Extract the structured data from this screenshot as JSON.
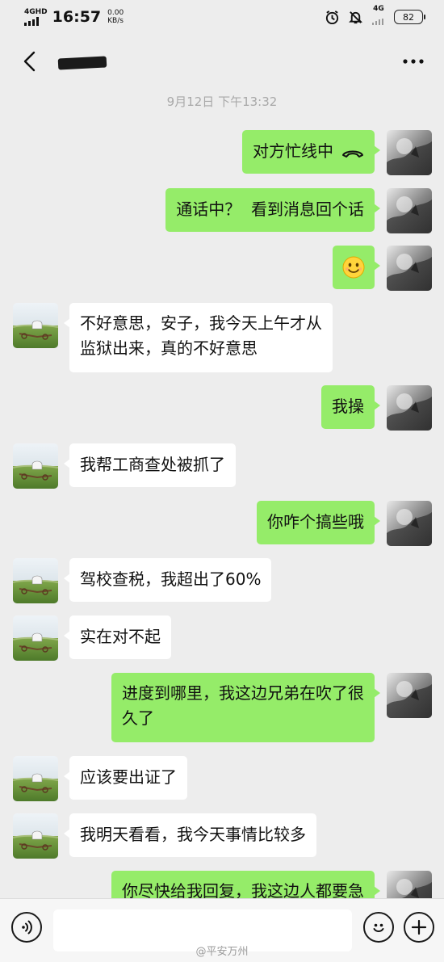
{
  "status_bar": {
    "network_type": "4GHD",
    "time": "16:57",
    "speed_value": "0.00",
    "speed_unit": "KB/s",
    "lte_label": "4G",
    "battery": "82"
  },
  "header": {
    "contact_name": "",
    "back_icon": "chevron-left-icon",
    "more_icon": "more-dots-icon"
  },
  "chat": {
    "timestamp": "9月12日 下午13:32",
    "messages": [
      {
        "side": "me",
        "text": "对方忙线中"
      },
      {
        "side": "me",
        "text": "通话中？  看到消息回个话"
      },
      {
        "side": "me",
        "text": "",
        "emoji": "smile-emoji-icon"
      },
      {
        "side": "other",
        "text": "不好意思，安子，我今天上午才从\n监狱出来，真的不好意思"
      },
      {
        "side": "me",
        "text": "我操"
      },
      {
        "side": "other",
        "text": "我帮工商查处被抓了"
      },
      {
        "side": "me",
        "text": "你咋个搞些哦"
      },
      {
        "side": "other",
        "text": "驾校查税，我超出了60%"
      },
      {
        "side": "other",
        "text": "实在对不起"
      },
      {
        "side": "me",
        "text": "进度到哪里，我这边兄弟在吹了很\n久了"
      },
      {
        "side": "other",
        "text": "应该要出证了"
      },
      {
        "side": "other",
        "text": "我明天看看，我今天事情比较多"
      },
      {
        "side": "me",
        "text": "你尽快给我回复，我这边人都要急"
      }
    ]
  },
  "input_bar": {
    "voice_icon": "voice-icon",
    "emoji_icon": "emoji-icon",
    "plus_icon": "plus-icon",
    "text_value": ""
  },
  "watermark": "@平安万州",
  "colors": {
    "background": "#ededed",
    "my_bubble": "#95ec69",
    "other_bubble": "#ffffff"
  }
}
